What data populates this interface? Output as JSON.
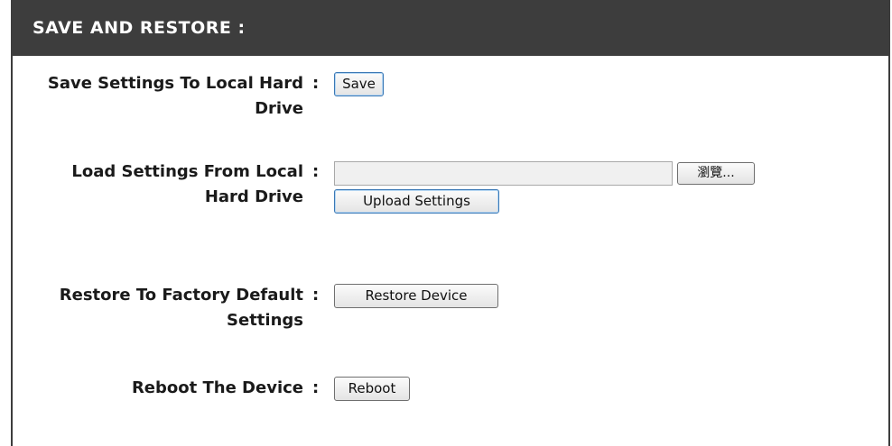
{
  "header": {
    "title": "SAVE AND RESTORE :"
  },
  "rows": {
    "save": {
      "label_line1": "Save Settings To Local Hard",
      "label_line2": "Drive",
      "button": "Save"
    },
    "load": {
      "label_line1": "Load Settings From Local",
      "label_line2": "Hard Drive",
      "file_value": "",
      "browse_button": "瀏覽...",
      "upload_button": "Upload Settings"
    },
    "restore": {
      "label_line1": "Restore To Factory Default",
      "label_line2": "Settings",
      "button": "Restore Device"
    },
    "reboot": {
      "label_line1": "Reboot The Device",
      "button": "Reboot"
    }
  },
  "colon": ":"
}
